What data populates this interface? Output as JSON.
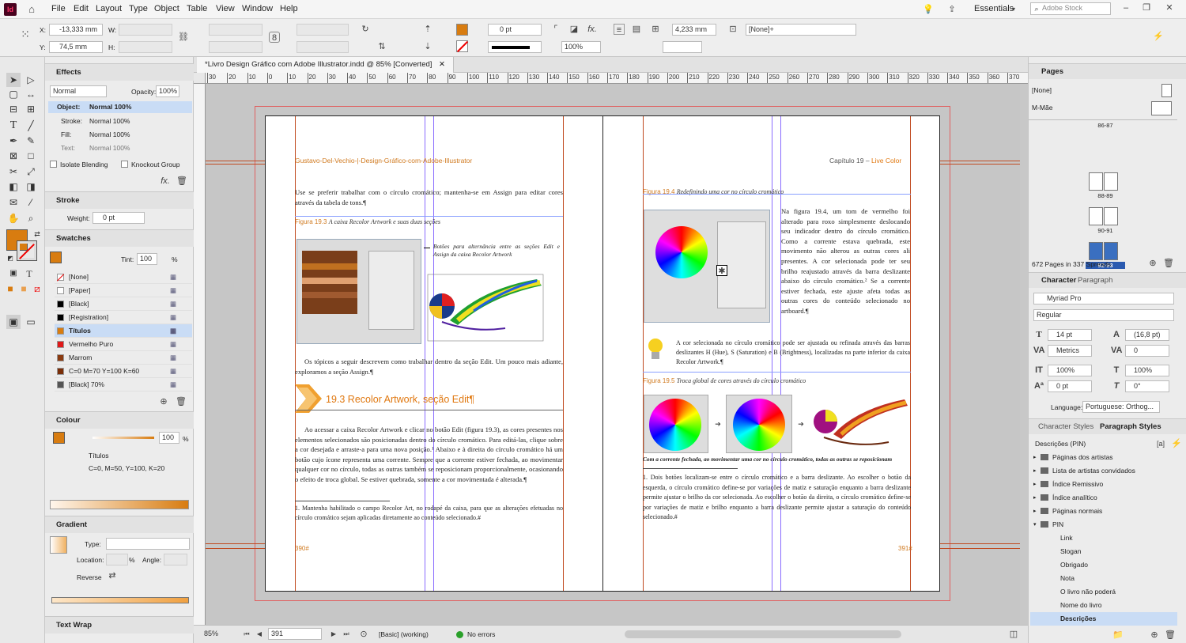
{
  "app": {
    "logo": "Id",
    "title": "Adobe InDesign"
  },
  "menu": [
    "File",
    "Edit",
    "Layout",
    "Type",
    "Object",
    "Table",
    "View",
    "Window",
    "Help"
  ],
  "workspace": {
    "name": "Essentials",
    "search_placeholder": "Adobe Stock"
  },
  "control": {
    "x_label": "X:",
    "x_value": "-13,333 mm",
    "y_label": "Y:",
    "y_value": "74,5 mm",
    "w_label": "W:",
    "h_label": "H:",
    "stroke_weight": "0 pt",
    "opacity_value": "100%",
    "measure_value": "4,233 mm",
    "object_style": "[None]+",
    "fill_color": "#d87c10"
  },
  "document": {
    "tab_title": "*Livro Design Gráfico com Adobe Illustrator.indd @ 85% [Converted]",
    "ruler_ticks": [
      "30",
      "20",
      "10",
      "0",
      "10",
      "20",
      "30",
      "40",
      "50",
      "60",
      "70",
      "80",
      "90",
      "100",
      "110",
      "120",
      "130",
      "140",
      "150",
      "160",
      "170",
      "180",
      "190",
      "200",
      "210",
      "220",
      "230",
      "240",
      "250",
      "260",
      "270",
      "280",
      "290",
      "300",
      "310",
      "320",
      "330",
      "340",
      "350",
      "360",
      "370"
    ],
    "left_page": {
      "header_left": "Gustavo-Del-Vechio-|-Design-Gráfico-com-Adobe-Illustrator",
      "para1": "Use se preferir trabalhar com o círculo cromático; mantenha-se em Assign para editar cores através da tabela de tons.¶",
      "fig_label": "Figura 19.3",
      "fig_caption": "A caixa Recolor Artwork e suas duas seções",
      "callout": "Botões para alternância entre as seções Edit e Assign da caixa Recolor Artwork",
      "para2": "Os tópicos a seguir descrevem como trabalhar dentro da seção Edit. Um pouco mais adiante, exploramos a seção Assign.¶",
      "section_heading": "19.3 Recolor Artwork, seção Edit¶",
      "para3": "Ao acessar a caixa Recolor Artwork e clicar no botão Edit (figura 19.3), as cores presentes nos elementos selecionados são posicionadas dentro do círculo cromático. Para editá-las, clique sobre a cor desejada e arraste-a para uma nova posição.¹ Abaixo e à direita do círculo cromático há um botão cujo ícone representa uma corrente. Sempre que a corrente estiver fechada, ao movimentar qualquer cor no círculo, todas as outras também se reposicionam proporcionalmente, ocasionando o efeito de troca global. Se estiver quebrada, somente a cor movimentada é alterada.¶",
      "footnote": "1. Mantenha habilitado o campo Recolor Art, no rodapé da caixa, para que as alterações efetuadas no círculo cromático sejam aplicadas diretamente ao conteúdo selecionado.#",
      "page_number": "390#"
    },
    "right_page": {
      "header_right_a": "Capítulo 19 – ",
      "header_right_b": "Live Color",
      "fig4_label": "Figura 19.4",
      "fig4_caption": "Redefinindo uma cor no círculo cromático",
      "para1": "Na figura 19.4, um tom de vermelho foi alterado para roxo simplesmente deslocando seu indicador dentro do círculo cromático. Como a corrente estava quebrada, este movimento não alterou as outras cores ali presentes. A cor selecionada pode ter seu brilho reajustado através da barra deslizante abaixo do círculo cromático.² Se a corrente estiver fechada, este ajuste afeta todas as outras cores do conteúdo selecionado no artboard.¶",
      "tip": "A cor selecionada no círculo cromático pode ser ajustada ou refinada através das barras deslizantes H (Hue), S (Saturation) e B (Brightness), localizadas na parte inferior da caixa Recolor Artwork.¶",
      "fig5_label": "Figura 19.5",
      "fig5_caption": "Troca global de cores através do círculo cromático",
      "fig5_note": "Com a corrente fechada, ao movimentar uma cor no círculo cromático, todas as outras se reposicionam",
      "footnote": "1. Dois botões localizam-se entre o círculo cromático e a barra deslizante. Ao escolher o botão da esquerda, o círculo cromático define-se por variações de matiz e saturação enquanto a barra deslizante permite ajustar o brilho da cor selecionada. Ao escolher o botão da direita, o círculo cromático define-se por variações de matiz e brilho enquanto a barra deslizante permite ajustar a saturação do conteúdo selecionado.#",
      "page_number": "391#"
    }
  },
  "status": {
    "zoom": "85%",
    "page": "391",
    "style": "[Basic] (working)",
    "preflight": "No errors"
  },
  "effects": {
    "title": "Effects",
    "blend": "Normal",
    "opacity_label": "Opacity:",
    "opacity": "100%",
    "rows": [
      {
        "label": "Object:",
        "value": "Normal 100%"
      },
      {
        "label": "Stroke:",
        "value": "Normal 100%"
      },
      {
        "label": "Fill:",
        "value": "Normal 100%"
      },
      {
        "label": "Text:",
        "value": "Normal 100%"
      }
    ],
    "isolate": "Isolate Blending",
    "knockout": "Knockout Group"
  },
  "stroke": {
    "title": "Stroke",
    "weight_label": "Weight:",
    "weight": "0 pt"
  },
  "swatches": {
    "title": "Swatches",
    "tint_label": "Tint:",
    "tint": "100",
    "pct": "%",
    "items": [
      {
        "name": "[None]",
        "color": "#ffffff"
      },
      {
        "name": "[Paper]",
        "color": "#ffffff"
      },
      {
        "name": "[Black]",
        "color": "#000000"
      },
      {
        "name": "[Registration]",
        "color": "#000000"
      },
      {
        "name": "Títulos",
        "color": "#d87c10"
      },
      {
        "name": "Vermelho Puro",
        "color": "#e01818"
      },
      {
        "name": "Marrom",
        "color": "#8a3a10"
      },
      {
        "name": "C=0 M=70 Y=100 K=60",
        "color": "#7a2e08"
      },
      {
        "name": "[Black] 70%",
        "color": "#555555"
      }
    ]
  },
  "colour": {
    "title": "Colour",
    "value": "100",
    "pct": "%",
    "swatch_name": "Títulos",
    "formula": "C=0, M=50, Y=100, K=20"
  },
  "gradient": {
    "title": "Gradient",
    "type_label": "Type:",
    "location_label": "Location:",
    "angle_label": "Angle:",
    "pct": "%",
    "reverse_label": "Reverse"
  },
  "textwrap": {
    "title": "Text Wrap"
  },
  "pages": {
    "title": "Pages",
    "none": "[None]",
    "master": "M-Mãe",
    "spreads": [
      "86-87",
      "88-89",
      "90-91",
      "92-93"
    ],
    "summary": "672 Pages in 337 Spreads"
  },
  "character": {
    "tab1": "Character",
    "tab2": "Paragraph",
    "font": "Myriad Pro",
    "style": "Regular",
    "size": "14 pt",
    "leading": "(16,8 pt)",
    "kerning": "Metrics",
    "tracking": "0",
    "vscale": "100%",
    "hscale": "100%",
    "baseline": "0 pt",
    "skew": "0°",
    "language_label": "Language:",
    "language": "Portuguese: Orthog..."
  },
  "styles": {
    "tab1": "Character Styles",
    "tab2": "Paragraph Styles",
    "current": "Descrições (PIN)",
    "groups": [
      "Páginas dos artistas",
      "Lista de artistas convidados",
      "Índice Remissivo",
      "Índice analítico",
      "Páginas normais",
      "PIN"
    ],
    "items": [
      "Link",
      "Slogan",
      "Obrigado",
      "Nota",
      "O livro não poderá",
      "Nome do livro",
      "Descrições"
    ]
  }
}
